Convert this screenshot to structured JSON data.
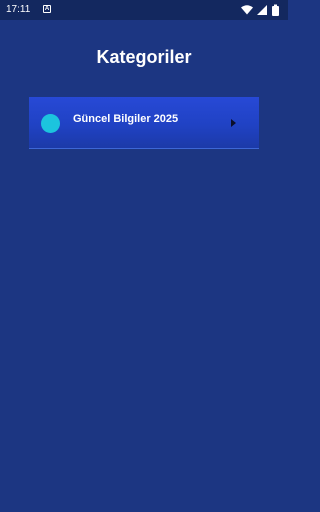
{
  "status_bar": {
    "time": "17:11",
    "notification_icon_letter": "A",
    "icons": [
      "wifi-icon",
      "signal-icon",
      "battery-icon"
    ]
  },
  "page": {
    "title": "Kategoriler"
  },
  "categories": [
    {
      "label": "Güncel Bilgiler 2025",
      "dot_color": "#1cc4de",
      "icon": "chevron-right-icon"
    }
  ],
  "colors": {
    "background": "#1c3682",
    "status_bar": "#13285f",
    "card": "#2446cf",
    "accent": "#1cc4de"
  }
}
